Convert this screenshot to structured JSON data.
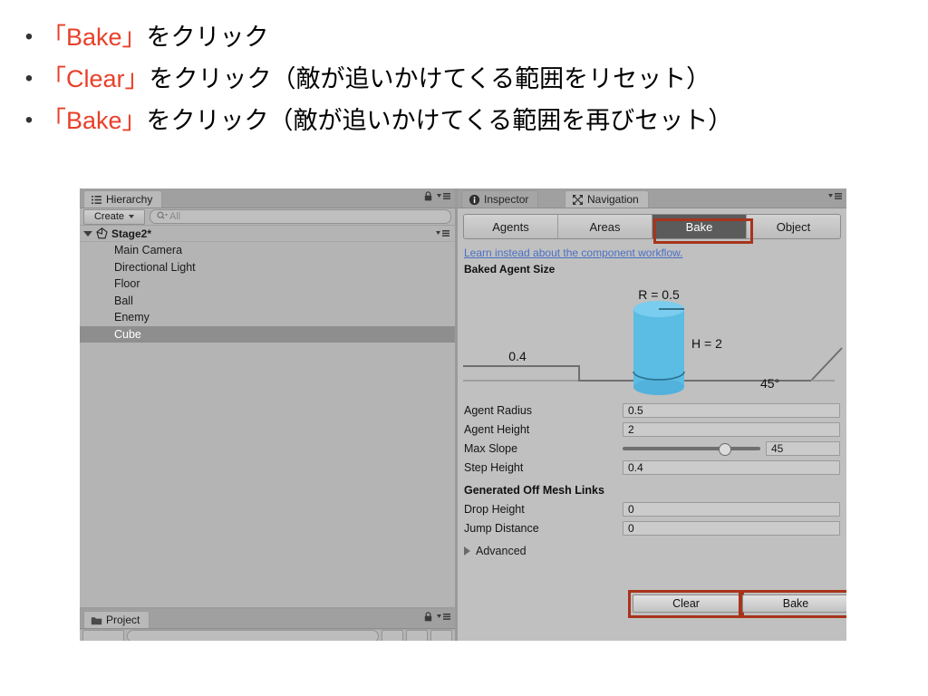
{
  "slide": {
    "bullets": [
      {
        "marker": "•",
        "pre": "",
        "highlight": "「Bake」",
        "post": "をクリック"
      },
      {
        "marker": "•",
        "pre": "",
        "highlight": "「Clear」",
        "post": "をクリック（敵が追いかけてくる範囲をリセット）"
      },
      {
        "marker": "•",
        "pre": "",
        "highlight": "「Bake」",
        "post": "をクリック（敵が追いかけてくる範囲を再びセット）"
      }
    ],
    "highlight_color": "#e8402a"
  },
  "editor": {
    "hierarchy": {
      "tab_label": "Hierarchy",
      "tab_icon": "hierarchy-list-icon",
      "lock_icon": "lock-icon",
      "menu_icon": "panel-menu-icon",
      "create_button": "Create",
      "search_placeholder": "All",
      "search_icon": "search-icon",
      "scene_name": "Stage2*",
      "scene_icon": "unity-scene-icon",
      "items": [
        {
          "label": "Main Camera",
          "selected": false
        },
        {
          "label": "Directional Light",
          "selected": false
        },
        {
          "label": "Floor",
          "selected": false
        },
        {
          "label": "Ball",
          "selected": false
        },
        {
          "label": "Enemy",
          "selected": false
        },
        {
          "label": "Cube",
          "selected": true
        }
      ]
    },
    "project": {
      "tab_label": "Project",
      "tab_icon": "folder-icon",
      "lock_icon": "lock-icon",
      "menu_icon": "panel-menu-icon"
    },
    "inspector": {
      "tabs": [
        {
          "label": "Inspector",
          "icon": "info-icon",
          "active": false
        },
        {
          "label": "Navigation",
          "icon": "navigation-move-icon",
          "active": true
        }
      ],
      "menu_icon": "panel-menu-icon"
    },
    "navigation": {
      "mode_tabs": [
        {
          "label": "Agents",
          "active": false,
          "annotated": false
        },
        {
          "label": "Areas",
          "active": false,
          "annotated": false
        },
        {
          "label": "Bake",
          "active": true,
          "annotated": true
        },
        {
          "label": "Object",
          "active": false,
          "annotated": false
        }
      ],
      "learn_link": "Learn instead about the component workflow.",
      "baked_agent_size_title": "Baked Agent Size",
      "diagram": {
        "radius_label": "R = 0.5",
        "height_label": "H = 2",
        "step_label": "0.4",
        "slope_label": "45°",
        "cylinder_color": "#5bbce4"
      },
      "fields": [
        {
          "label": "Agent Radius",
          "value": "0.5",
          "type": "text"
        },
        {
          "label": "Agent Height",
          "value": "2",
          "type": "text"
        },
        {
          "label": "Max Slope",
          "value": "45",
          "type": "slider",
          "slider_percent": 70
        },
        {
          "label": "Step Height",
          "value": "0.4",
          "type": "text"
        }
      ],
      "off_mesh_title": "Generated Off Mesh Links",
      "off_mesh_fields": [
        {
          "label": "Drop Height",
          "value": "0"
        },
        {
          "label": "Jump Distance",
          "value": "0"
        }
      ],
      "advanced_label": "Advanced",
      "advanced_expanded": false,
      "buttons": [
        {
          "label": "Clear",
          "annotated": true
        },
        {
          "label": "Bake",
          "annotated": true
        }
      ]
    },
    "annotation_color": "#a8341c"
  }
}
